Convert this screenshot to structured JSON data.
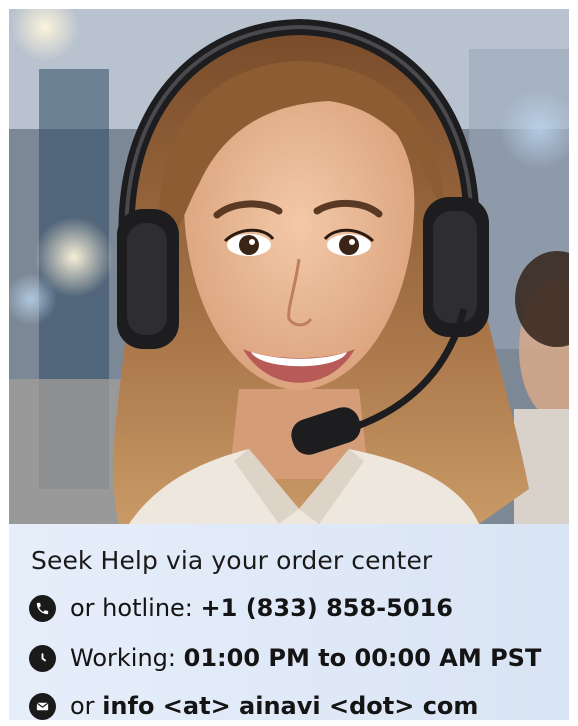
{
  "photo": {
    "subject": "customer-support-agent-with-headset",
    "colors": {
      "background": "#8e99a8",
      "hair": "#8a5a33",
      "skin": "#e8b594",
      "headset": "#1d1d1f",
      "shirt": "#efe9e1"
    }
  },
  "info": {
    "headline": "Seek Help via your order center",
    "hotline": {
      "icon": "phone-icon",
      "prefix": "or hotline:",
      "value": "+1 (833) 858-5016"
    },
    "hours": {
      "icon": "clock-icon",
      "prefix": "Working:",
      "value": "01:00 PM to 00:00 AM PST"
    },
    "email": {
      "icon": "envelope-icon",
      "prefix": "or",
      "value": "info <at> ainavi <dot> com"
    }
  }
}
